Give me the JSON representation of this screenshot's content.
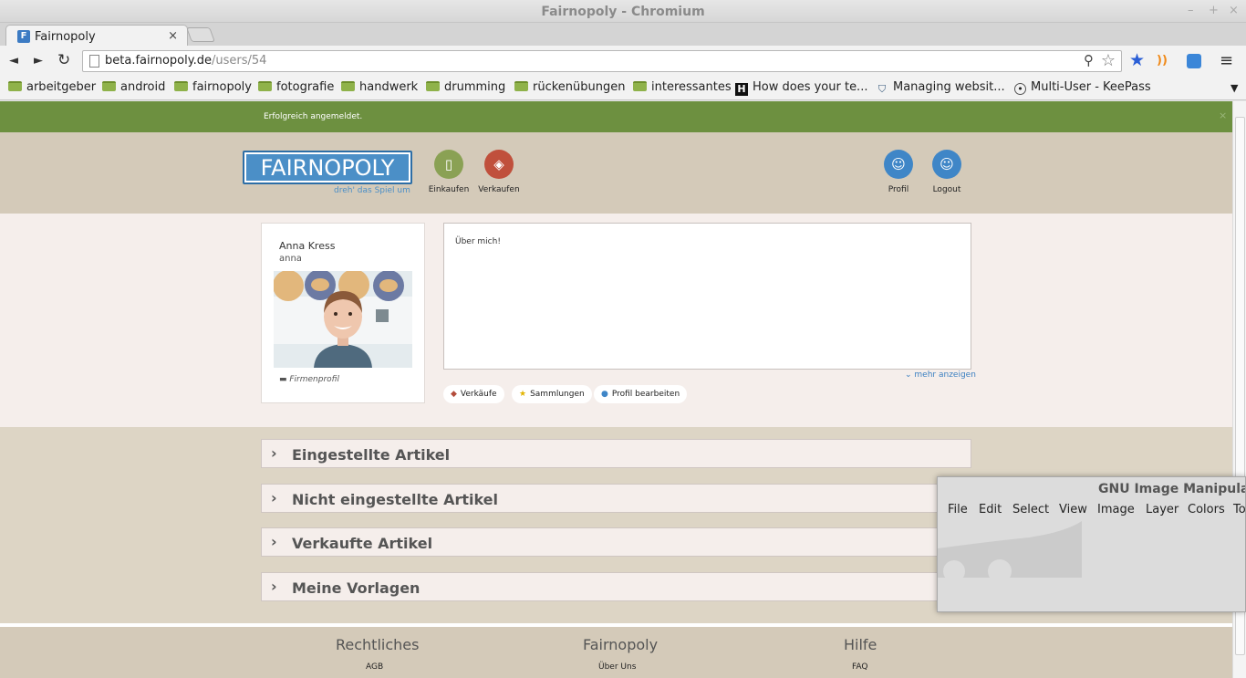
{
  "window": {
    "title": "Fairnopoly - Chromium",
    "controls": [
      "–",
      "+",
      "×"
    ]
  },
  "tab": {
    "title": "Fairnopoly",
    "favicon_letter": "F",
    "close": "×"
  },
  "omnibox": {
    "host": "beta.fairnopoly.de",
    "path": "/users/54"
  },
  "nav_icons": {
    "back": "◄",
    "forward": "►",
    "reload": "↻",
    "search": "⚲",
    "star": "☆",
    "bookmark_star": "★",
    "rss": "))",
    "menu": "≡"
  },
  "bookmarks": [
    {
      "label": "arbeitgeber",
      "icon": "folder-icon"
    },
    {
      "label": "android",
      "icon": "folder-icon"
    },
    {
      "label": "fairnopoly",
      "icon": "folder-icon"
    },
    {
      "label": "fotografie",
      "icon": "folder-icon"
    },
    {
      "label": "handwerk",
      "icon": "folder-icon"
    },
    {
      "label": "drumming",
      "icon": "folder-icon"
    },
    {
      "label": "rückenübungen",
      "icon": "folder-icon"
    },
    {
      "label": "interessantes",
      "icon": "folder-icon"
    },
    {
      "label": "How does your te...",
      "icon": "h-site-icon"
    },
    {
      "label": "Managing websit...",
      "icon": "shield-icon"
    },
    {
      "label": "Multi-User - KeePass",
      "icon": "lock-icon"
    }
  ],
  "bookmarks_overflow": "▼",
  "flash": {
    "message": "Erfolgreich angemeldet.",
    "close": "×"
  },
  "header": {
    "logo": "FAIRNOPOLY",
    "slogan": "dreh' das Spiel um",
    "einkaufen": "Einkaufen",
    "verkaufen": "Verkaufen",
    "profil": "Profil",
    "logout": "Logout"
  },
  "profile": {
    "name": "Anna Kress",
    "username": "anna",
    "firm": "Firmenprofil",
    "about": "Über mich!",
    "more": "mehr anzeigen",
    "buttons": {
      "sales": "Verkäufe",
      "collections": "Sammlungen",
      "edit": "Profil bearbeiten"
    }
  },
  "sections": [
    "Eingestellte Artikel",
    "Nicht eingestellte Artikel",
    "Verkaufte Artikel",
    "Meine Vorlagen"
  ],
  "footer": {
    "rechtliches": "Rechtliches",
    "agb": "AGB",
    "fairnopoly": "Fairnopoly",
    "ueber": "Über Uns",
    "hilfe": "Hilfe",
    "faq": "FAQ"
  },
  "gimp": {
    "title": "GNU Image Manipulat",
    "menu": [
      "File",
      "Edit",
      "Select",
      "View",
      "Image",
      "Layer",
      "Colors",
      "To"
    ]
  },
  "colors": {
    "flash_green": "#6d9040",
    "brand_blue": "#4b8fc7",
    "header_beige": "#d4cab9",
    "accent_red": "#c0503c"
  }
}
